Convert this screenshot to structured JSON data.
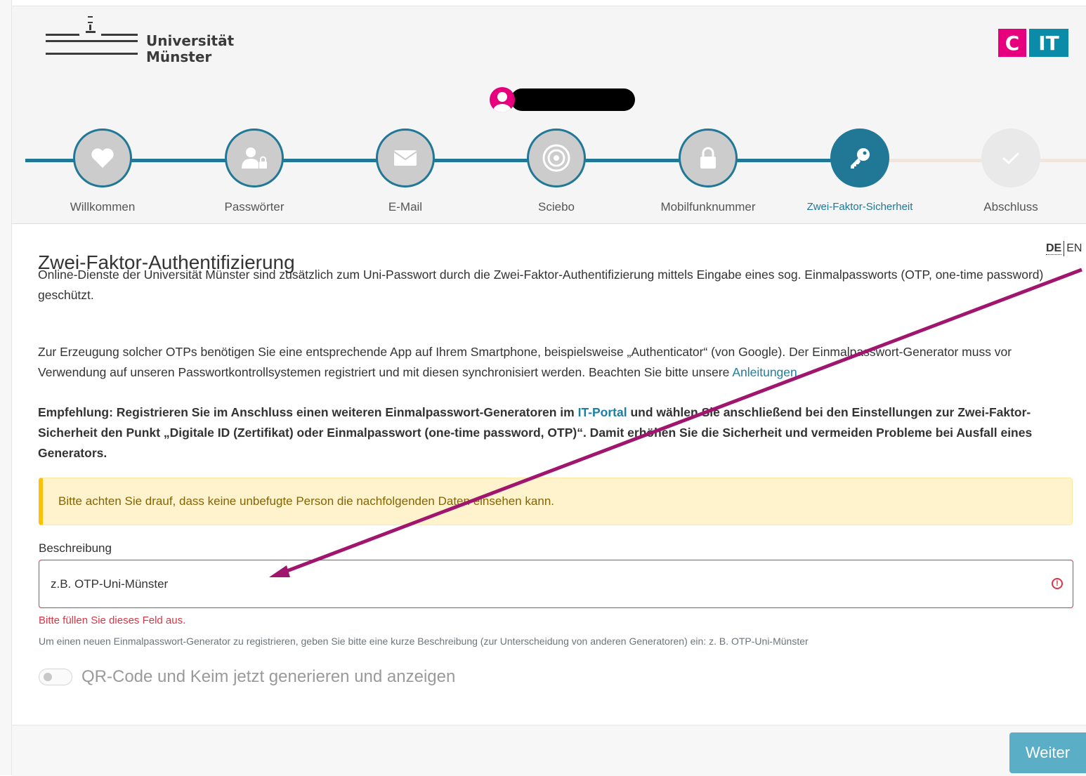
{
  "header": {
    "university_line1": "Universität",
    "university_line2": "Münster",
    "cit_c": "C",
    "cit_it": "IT"
  },
  "steps": [
    {
      "label": "Willkommen",
      "icon": "heart-icon",
      "state": "done"
    },
    {
      "label": "Passwörter",
      "icon": "user-lock-icon",
      "state": "done"
    },
    {
      "label": "E-Mail",
      "icon": "envelope-icon",
      "state": "done"
    },
    {
      "label": "Sciebo",
      "icon": "sciebo-icon",
      "state": "done"
    },
    {
      "label": "Mobilfunknummer",
      "icon": "lock-icon",
      "state": "done"
    },
    {
      "label": "Zwei-Faktor-Sicherheit",
      "icon": "key-icon",
      "state": "active"
    },
    {
      "label": "Abschluss",
      "icon": "check-icon",
      "state": "todo"
    }
  ],
  "lang": {
    "de": "DE",
    "en": "EN"
  },
  "main": {
    "title": "Zwei-Faktor-Authentifizierung",
    "intro": "Online-Dienste der Universität Münster sind zusätzlich zum Uni-Passwort durch die Zwei-Faktor-Authentifizierung mittels Eingabe eines sog. Einmalpassworts (OTP, one-time password) geschützt.",
    "p2_text": "Zur Erzeugung solcher OTPs benötigen Sie eine entsprechende App auf Ihrem Smartphone, beispielsweise „Authenticator“ (von Google). Der Einmalpasswort-Generator muss vor Verwendung auf unseren Passwortkontrollsystemen registriert und mit diesen synchronisiert werden. Beachten Sie bitte unsere ",
    "p2_link": "Anleitungen",
    "p2_end": ".",
    "p3_before": "Empfehlung: Registrieren Sie im Anschluss einen weiteren Einmalpasswort-Generatoren im ",
    "p3_link": "IT-Portal",
    "p3_after": " und wählen Sie anschließend bei den Einstellungen zur Zwei-Faktor-Sicherheit den Punkt „Digitale ID (Zertifikat) oder Einmalpasswort (one-time password, OTP)“. Damit erhöhen Sie die Sicherheit und vermeiden Probleme bei Ausfall eines Generators.",
    "alert": "Bitte achten Sie drauf, dass keine unbefugte Person die nachfolgenden Daten einsehen kann.",
    "field_label": "Beschreibung",
    "field_placeholder": "z.B. OTP-Uni-Münster",
    "field_value": "",
    "field_error_icon": "!",
    "field_error": "Bitte füllen Sie dieses Feld aus.",
    "field_help": "Um einen neuen Einmalpasswort-Generator zu registrieren, geben Sie bitte eine kurze Beschreibung (zur Unterscheidung von anderen Generatoren) ein: z. B. OTP-Uni-Münster",
    "toggle_label": "QR-Code und Keim jetzt generieren und anzeigen",
    "toggle_on": false
  },
  "footer": {
    "next_label": "Weiter"
  },
  "colors": {
    "brand_magenta": "#e6007e",
    "brand_teal": "#207896",
    "annotation_arrow": "#a0166e",
    "error": "#dc3545"
  }
}
